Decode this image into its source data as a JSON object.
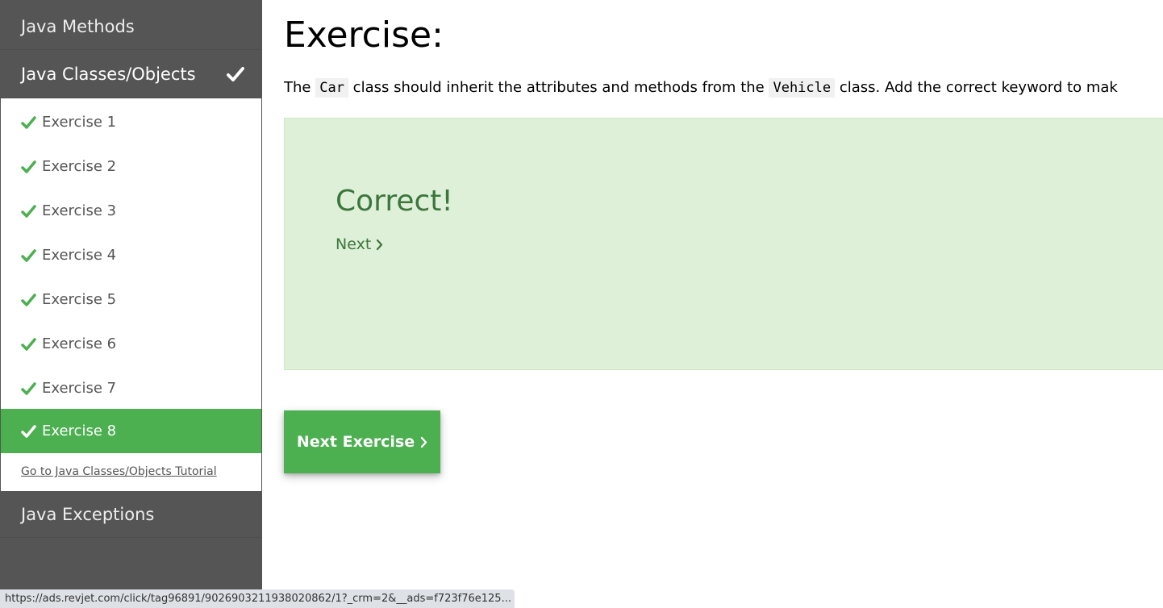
{
  "sidebar": {
    "categories": {
      "methods": "Java Methods",
      "classes": "Java Classes/Objects",
      "exceptions": "Java Exceptions"
    },
    "exercises": [
      "Exercise 1",
      "Exercise 2",
      "Exercise 3",
      "Exercise 4",
      "Exercise 5",
      "Exercise 6",
      "Exercise 7",
      "Exercise 8"
    ],
    "active_exercise": "Exercise 8",
    "tutorial_link": "Go to Java Classes/Objects Tutorial",
    "icons": {
      "completed": "checkmark-icon"
    },
    "colors": {
      "bg": "#555555",
      "active": "#4caf50",
      "check": "#4caf50"
    }
  },
  "main": {
    "title": "Exercise:",
    "instruction": {
      "part1": "The",
      "code1": "Car",
      "part2": "class should inherit the attributes and methods from the",
      "code2": "Vehicle",
      "part3": "class. Add the correct keyword to mak"
    },
    "result": {
      "heading": "Correct!",
      "next_label": "Next"
    },
    "next_button": "Next Exercise",
    "icons": {
      "next": "chevron-right-icon"
    },
    "colors": {
      "success_bg": "#dff0d8",
      "success_text": "#3c763d"
    }
  },
  "statusbar": {
    "url": "https://ads.revjet.com/click/tag96891/9026903211938020862/1?_crm=2&__ads=f723f76e125..."
  }
}
